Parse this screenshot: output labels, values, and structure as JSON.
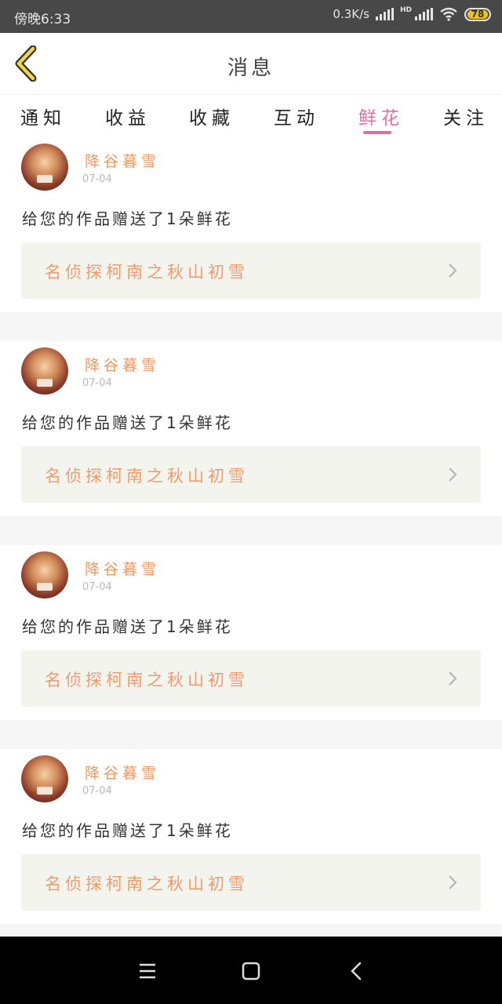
{
  "status": {
    "time": "傍晚6:33",
    "network_speed": "0.3K/s",
    "hd": "HD",
    "battery": "78"
  },
  "header": {
    "title": "消息",
    "back_icon": "chevron-left-icon"
  },
  "tabs": [
    {
      "label": "通知",
      "active": false
    },
    {
      "label": "收益",
      "active": false
    },
    {
      "label": "收藏",
      "active": false
    },
    {
      "label": "互动",
      "active": false
    },
    {
      "label": "鲜花",
      "active": true
    },
    {
      "label": "关注",
      "active": false
    }
  ],
  "colors": {
    "accent_pink": "#e86aa0",
    "username_orange": "#f0965f",
    "work_title_orange": "#ef9a6a",
    "work_bg": "#f4f4ef"
  },
  "messages": [
    {
      "username": "降谷暮雪",
      "date": "07-04",
      "text": "给您的作品赠送了1朵鲜花",
      "work_title": "名侦探柯南之秋山初雪"
    },
    {
      "username": "降谷暮雪",
      "date": "07-04",
      "text": "给您的作品赠送了1朵鲜花",
      "work_title": "名侦探柯南之秋山初雪"
    },
    {
      "username": "降谷暮雪",
      "date": "07-04",
      "text": "给您的作品赠送了1朵鲜花",
      "work_title": "名侦探柯南之秋山初雪"
    },
    {
      "username": "降谷暮雪",
      "date": "07-04",
      "text": "给您的作品赠送了1朵鲜花",
      "work_title": "名侦探柯南之秋山初雪"
    }
  ],
  "navbar": {
    "icons": [
      "menu-icon",
      "home-square-icon",
      "back-triangle-icon"
    ]
  }
}
